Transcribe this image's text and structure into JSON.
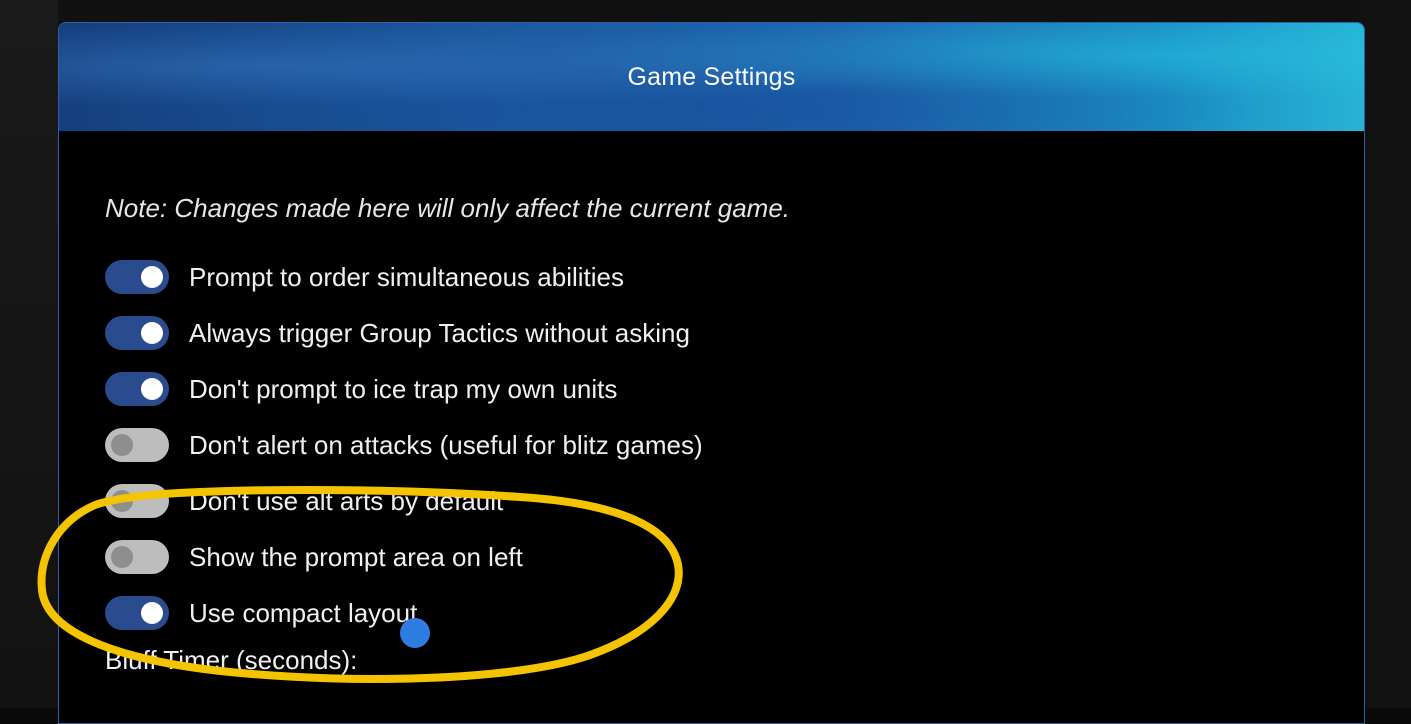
{
  "dialog": {
    "title": "Game Settings",
    "note": "Note: Changes made here will only affect the current game.",
    "options": [
      {
        "label": "Prompt to order simultaneous abilities",
        "enabled": true
      },
      {
        "label": "Always trigger Group Tactics without asking",
        "enabled": true
      },
      {
        "label": "Don't prompt to ice trap my own units",
        "enabled": true
      },
      {
        "label": "Don't alert on attacks (useful for blitz games)",
        "enabled": false
      },
      {
        "label": "Don't use alt arts by default",
        "enabled": false
      },
      {
        "label": "Show the prompt area on left",
        "enabled": false
      },
      {
        "label": "Use compact layout",
        "enabled": true
      }
    ],
    "bluff_timer_label": "Bluff Timer (seconds):"
  },
  "colors": {
    "toggle_on": "#2a4b8e",
    "toggle_off": "#bdbdbd",
    "annotation": "#f5c400",
    "border": "#2f5fa5"
  },
  "annotation": {
    "shape": "hand-drawn-ellipse",
    "color": "#f5c400"
  }
}
